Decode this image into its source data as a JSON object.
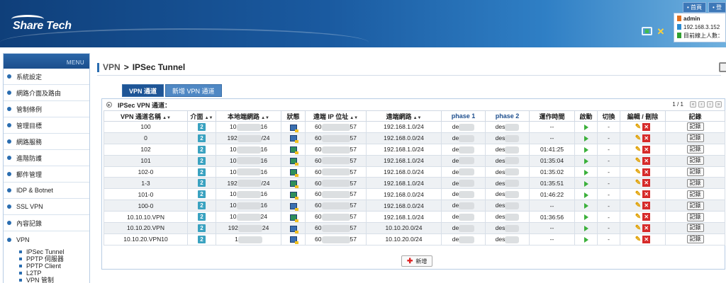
{
  "header": {
    "logo": "Share Tech",
    "top_links": [
      "首頁",
      "登"
    ],
    "user": {
      "name": "admin",
      "ip": "192.168.3.152",
      "online_label": "目前線上人數："
    }
  },
  "sidebar": {
    "menu_label": "MENU",
    "items": [
      "系統設定",
      "網路介面及路由",
      "管制條例",
      "管理目標",
      "網路服務",
      "進階防護",
      "郵件管理",
      "IDP & Botnet",
      "SSL VPN",
      "內容記錄",
      "VPN"
    ],
    "vpn_sub": [
      "IPSec Tunnel",
      "PPTP 伺服器",
      "PPTP Client",
      "L2TP",
      "VPN 管制"
    ]
  },
  "breadcrumb": {
    "section": "VPN",
    "sep": ">",
    "page": "IPSec Tunnel"
  },
  "tabs": [
    "VPN 通道",
    "新增 VPN 通道"
  ],
  "panel": {
    "title": "IPSec VPN 通道：",
    "page_info": "1 / 1"
  },
  "table": {
    "headers": [
      "VPN 通道名稱",
      "介面",
      "本地端網路",
      "狀態",
      "遠端 IP 位址",
      "遠端網路",
      "phase 1",
      "phase 2",
      "運作時間",
      "啟動",
      "切換",
      "編輯 / 刪除",
      "記錄"
    ],
    "rows": [
      {
        "name": "100",
        "iface": "2",
        "local_a": "10",
        "local_b": "16",
        "status": "off",
        "remote_ip_a": "60",
        "remote_ip_b": "57",
        "remote_net": "192.168.1.0/24",
        "p1": "de",
        "p2": "des",
        "uptime": "--",
        "switch": "-",
        "log": "記錄"
      },
      {
        "name": "0",
        "iface": "2",
        "local_a": "192",
        "local_b": "/24",
        "status": "off",
        "remote_ip_a": "60",
        "remote_ip_b": "57",
        "remote_net": "192.168.0.0/24",
        "p1": "de",
        "p2": "des",
        "uptime": "--",
        "switch": "-",
        "log": "記錄"
      },
      {
        "name": "102",
        "iface": "2",
        "local_a": "10",
        "local_b": "16",
        "status": "on",
        "remote_ip_a": "60",
        "remote_ip_b": "57",
        "remote_net": "192.168.1.0/24",
        "p1": "de",
        "p2": "des",
        "uptime": "01:41:25",
        "switch": "-",
        "log": "記錄"
      },
      {
        "name": "101",
        "iface": "2",
        "local_a": "10",
        "local_b": "16",
        "status": "on",
        "remote_ip_a": "60",
        "remote_ip_b": "57",
        "remote_net": "192.168.1.0/24",
        "p1": "de",
        "p2": "des",
        "uptime": "01:35:04",
        "switch": "-",
        "log": "記錄"
      },
      {
        "name": "102-0",
        "iface": "2",
        "local_a": "10",
        "local_b": "16",
        "status": "on",
        "remote_ip_a": "60",
        "remote_ip_b": "57",
        "remote_net": "192.168.0.0/24",
        "p1": "de",
        "p2": "des",
        "uptime": "01:35:02",
        "switch": "-",
        "log": "記錄"
      },
      {
        "name": "1-3",
        "iface": "2",
        "local_a": "192",
        "local_b": "/24",
        "status": "on",
        "remote_ip_a": "60",
        "remote_ip_b": "57",
        "remote_net": "192.168.1.0/24",
        "p1": "de",
        "p2": "des",
        "uptime": "01:35:51",
        "switch": "-",
        "log": "記錄"
      },
      {
        "name": "101-0",
        "iface": "2",
        "local_a": "10",
        "local_b": "16",
        "status": "on",
        "remote_ip_a": "60",
        "remote_ip_b": "57",
        "remote_net": "192.168.0.0/24",
        "p1": "de",
        "p2": "des",
        "uptime": "01:46:22",
        "switch": "-",
        "log": "記錄"
      },
      {
        "name": "100-0",
        "iface": "2",
        "local_a": "10",
        "local_b": "16",
        "status": "off",
        "remote_ip_a": "60",
        "remote_ip_b": "57",
        "remote_net": "192.168.0.0/24",
        "p1": "de",
        "p2": "des",
        "uptime": "--",
        "switch": "-",
        "log": "記錄"
      },
      {
        "name": "10.10.10.VPN",
        "iface": "2",
        "local_a": "10",
        "local_b": "24",
        "status": "on",
        "remote_ip_a": "60",
        "remote_ip_b": "57",
        "remote_net": "192.168.1.0/24",
        "p1": "de",
        "p2": "des",
        "uptime": "01:36:56",
        "switch": "-",
        "log": "記錄"
      },
      {
        "name": "10.10.20.VPN",
        "iface": "2",
        "local_a": "192",
        "local_b": "24",
        "status": "off",
        "remote_ip_a": "60",
        "remote_ip_b": "57",
        "remote_net": "10.10.20.0/24",
        "p1": "de",
        "p2": "des",
        "uptime": "--",
        "switch": "-",
        "log": "記錄"
      },
      {
        "name": "10.10.20.VPN10",
        "iface": "2",
        "local_a": "1",
        "local_b": "",
        "status": "off",
        "remote_ip_a": "60",
        "remote_ip_b": "57",
        "remote_net": "10.10.20.0/24",
        "p1": "de",
        "p2": "des",
        "uptime": "--",
        "switch": "-",
        "log": "記錄"
      }
    ]
  },
  "add_button": "新增"
}
